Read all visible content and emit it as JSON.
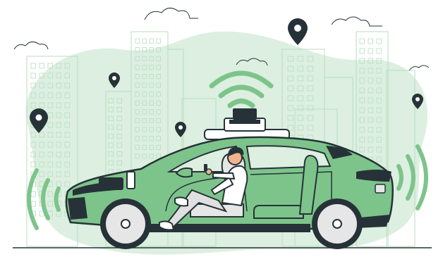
{
  "illustration": {
    "subject": "autonomous-car-with-passenger",
    "colors": {
      "accent": "#7dc48b",
      "blob": "#dcefe0",
      "car_body": "#7dc48b",
      "car_dark": "#263238",
      "outline": "#263238",
      "building_line": "#b9dcc0",
      "skin": "#f2b48a",
      "shirt": "#ffffff",
      "pants": "#e0e0e0"
    },
    "icons": [
      "map-pin-icon",
      "wifi-signal-icon",
      "sensor-wave-icon",
      "cloud-icon",
      "smartphone-icon"
    ]
  }
}
